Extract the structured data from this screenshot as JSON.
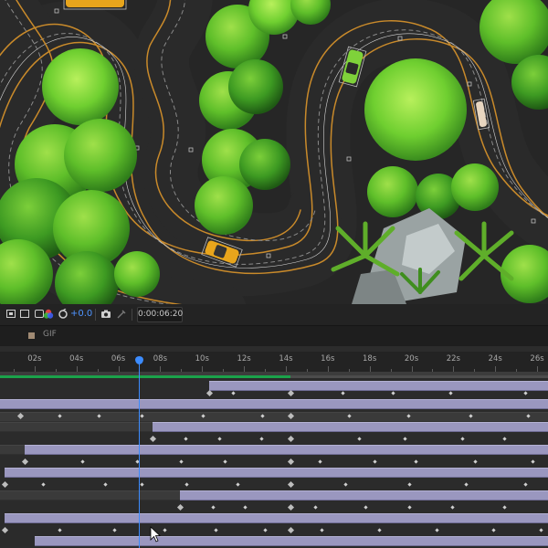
{
  "toolbar": {
    "exposure": "+0.0",
    "timecode": "0:00:06:20",
    "icons": [
      "region-of-interest-icon",
      "toggle-grid-icon",
      "monitor-icon",
      "color-channels-icon",
      "reset-exposure-icon",
      "snapshot-camera-icon",
      "show-snapshot-icon"
    ]
  },
  "timeline": {
    "comp_name": "GIF",
    "comp_color": "#a08a73",
    "ruler_labels": [
      "s",
      "02s",
      "04s",
      "06s",
      "08s",
      "10s",
      "12s",
      "14s",
      "16s",
      "18s",
      "20s",
      "22s",
      "24s",
      "26s"
    ],
    "current_time": "0:00:06:20",
    "layer_color": "#9a97bf",
    "playhead_color": "#3c8cff"
  },
  "viewer": {
    "scene": "top-down racing track with trees and cars",
    "track_color": "#2b2b2b",
    "lane_line_color": "#c98a2a"
  }
}
